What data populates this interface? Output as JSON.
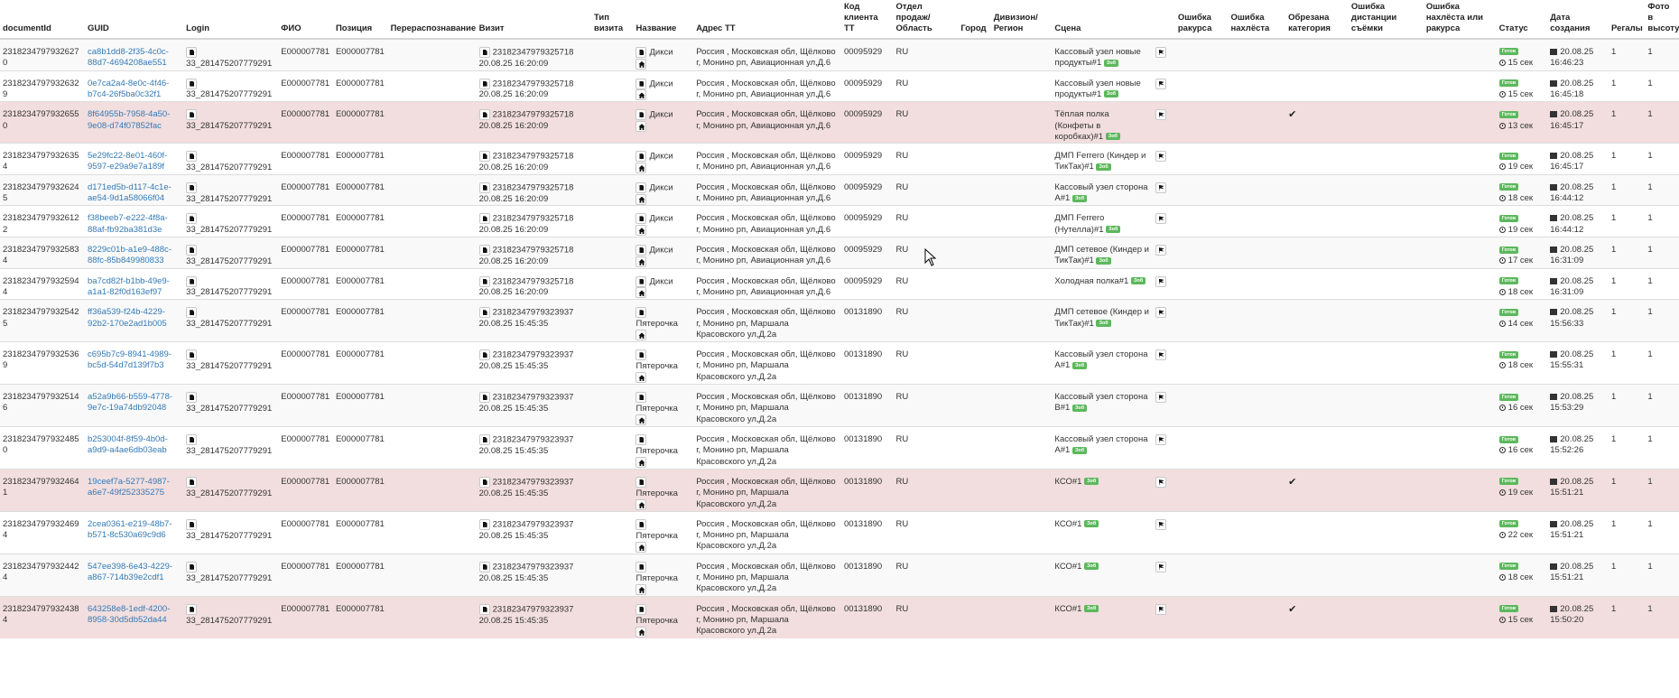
{
  "headers": [
    "documentId",
    "GUID",
    "Login",
    "ФИО",
    "Позиция",
    "Перераспознавание",
    "Визит",
    "Тип визита",
    "Название",
    "Адрес ТТ",
    "Код клиента ТТ",
    "Отдел продаж/ Область",
    "Город",
    "Дивизион/ Регион",
    "Сцена",
    "",
    "Ошибка ракурса",
    "Ошибка нахлёста",
    "Обрезана категория",
    "Ошибка дистанции съёмки",
    "Ошибка нахлёста или ракурса",
    "Статус",
    "Дата создания",
    "Регалы",
    "Фото в высоту"
  ],
  "icons": {
    "file": "file-icon",
    "home": "home-icon",
    "flag": "flag-icon",
    "clock": "clock-icon",
    "calendar": "calendar-icon",
    "check": "checkmark-icon"
  },
  "colors": {
    "highlight_row": "#f2dede",
    "badge": "#5cb85c",
    "link": "#337ab7"
  },
  "rows": [
    {
      "doc": "2318234797932627‍0",
      "guid": "ca8b1dd8-2f35-4c0c-88d7-4694208ae551",
      "login": "33_281475207779291",
      "fio": "E000007781",
      "pos": "E000007781",
      "visit_id": "2318234797932571‍8",
      "visit_time": "20.08.25 16:20:09",
      "store": "Дикси",
      "addr": "Россия , Московская обл, Щёлково г, Монино рп, Авиационная ул,Д.6",
      "code": "00095929",
      "region": "RU",
      "scene": "Кассовый узел новые продукты#1",
      "crop": false,
      "status": "Готов",
      "dur": "15 сек",
      "created_d": "20.08.25",
      "created_t": "16:46:23",
      "regals": "1",
      "photo": "1",
      "hl": false
    },
    {
      "doc": "2318234797932632‍9",
      "guid": "0e7ca2a4-8e0c-4f46-b7c4-26f5ba0c32f1",
      "login": "33_281475207779291",
      "fio": "E000007781",
      "pos": "E000007781",
      "visit_id": "2318234797932571‍8",
      "visit_time": "20.08.25 16:20:09",
      "store": "Дикси",
      "addr": "Россия , Московская обл, Щёлково г, Монино рп, Авиационная ул,Д.6",
      "code": "00095929",
      "region": "RU",
      "scene": "Кассовый узел новые продукты#1",
      "crop": false,
      "status": "Готов",
      "dur": "15 сек",
      "created_d": "20.08.25",
      "created_t": "16:45:18",
      "regals": "1",
      "photo": "1",
      "hl": false
    },
    {
      "doc": "2318234797932655‍0",
      "guid": "8f64955b-7958-4a50-9e08-d74f07852fac",
      "login": "33_281475207779291",
      "fio": "E000007781",
      "pos": "E000007781",
      "visit_id": "2318234797932571‍8",
      "visit_time": "20.08.25 16:20:09",
      "store": "Дикси",
      "addr": "Россия , Московская обл, Щёлково г, Монино рп, Авиационная ул,Д.6",
      "code": "00095929",
      "region": "RU",
      "scene": "Тёплая полка (Конфеты в коробках)#1",
      "crop": true,
      "status": "Готов",
      "dur": "13 сек",
      "created_d": "20.08.25",
      "created_t": "16:45:17",
      "regals": "1",
      "photo": "1",
      "hl": true
    },
    {
      "doc": "2318234797932635‍4",
      "guid": "5e29fc22-8e01-460f-9597-e29a9e7a189f",
      "login": "33_281475207779291",
      "fio": "E000007781",
      "pos": "E000007781",
      "visit_id": "2318234797932571‍8",
      "visit_time": "20.08.25 16:20:09",
      "store": "Дикси",
      "addr": "Россия , Московская обл, Щёлково г, Монино рп, Авиационная ул,Д.6",
      "code": "00095929",
      "region": "RU",
      "scene": "ДМП Ferrero (Киндер и ТикТак)#1",
      "crop": false,
      "status": "Готов",
      "dur": "19 сек",
      "created_d": "20.08.25",
      "created_t": "16:45:17",
      "regals": "1",
      "photo": "1",
      "hl": false
    },
    {
      "doc": "2318234797932624‍5",
      "guid": "d171ed5b-d117-4c1e-ae54-9d1a58066f04",
      "login": "33_281475207779291",
      "fio": "E000007781",
      "pos": "E000007781",
      "visit_id": "2318234797932571‍8",
      "visit_time": "20.08.25 16:20:09",
      "store": "Дикси",
      "addr": "Россия , Московская обл, Щёлково г, Монино рп, Авиационная ул,Д.6",
      "code": "00095929",
      "region": "RU",
      "scene": "Кассовый узел сторона А#1",
      "crop": false,
      "status": "Готов",
      "dur": "18 сек",
      "created_d": "20.08.25",
      "created_t": "16:44:12",
      "regals": "1",
      "photo": "1",
      "hl": false
    },
    {
      "doc": "2318234797932612‍2",
      "guid": "f38beeb7-e222-4f8a-88af-fb92ba381d3e",
      "login": "33_281475207779291",
      "fio": "E000007781",
      "pos": "E000007781",
      "visit_id": "2318234797932571‍8",
      "visit_time": "20.08.25 16:20:09",
      "store": "Дикси",
      "addr": "Россия , Московская обл, Щёлково г, Монино рп, Авиационная ул,Д.6",
      "code": "00095929",
      "region": "RU",
      "scene": "ДМП Ferrero (Нутелла)#1",
      "crop": false,
      "status": "Готов",
      "dur": "19 сек",
      "created_d": "20.08.25",
      "created_t": "16:44:12",
      "regals": "1",
      "photo": "1",
      "hl": false
    },
    {
      "doc": "2318234797932583‍4",
      "guid": "8229c01b-a1e9-488c-88fc-85b849980833",
      "login": "33_281475207779291",
      "fio": "E000007781",
      "pos": "E000007781",
      "visit_id": "2318234797932571‍8",
      "visit_time": "20.08.25 16:20:09",
      "store": "Дикси",
      "addr": "Россия , Московская обл, Щёлково г, Монино рп, Авиационная ул,Д.6",
      "code": "00095929",
      "region": "RU",
      "scene": "ДМП сетевое (Киндер и ТикТак)#1",
      "crop": false,
      "status": "Готов",
      "dur": "17 сек",
      "created_d": "20.08.25",
      "created_t": "16:31:09",
      "regals": "1",
      "photo": "1",
      "hl": false
    },
    {
      "doc": "2318234797932594‍4",
      "guid": "ba7cd82f-b1bb-49e9-a1a1-82f0d163ef97",
      "login": "33_281475207779291",
      "fio": "E000007781",
      "pos": "E000007781",
      "visit_id": "2318234797932571‍8",
      "visit_time": "20.08.25 16:20:09",
      "store": "Дикси",
      "addr": "Россия , Московская обл, Щёлково г, Монино рп, Авиационная ул,Д.6",
      "code": "00095929",
      "region": "RU",
      "scene": "Холодная полка#1",
      "crop": false,
      "status": "Готов",
      "dur": "18 сек",
      "created_d": "20.08.25",
      "created_t": "16:31:09",
      "regals": "1",
      "photo": "1",
      "hl": false
    },
    {
      "doc": "2318234797932542‍5",
      "guid": "ff36a539-f24b-4229-92b2-170e2ad1b005",
      "login": "33_281475207779291",
      "fio": "E000007781",
      "pos": "E000007781",
      "visit_id": "2318234797932393‍7",
      "visit_time": "20.08.25 15:45:35",
      "store": "Пятерочка",
      "addr": "Россия , Московская обл, Щёлково г, Монино рп, Маршала Красовского ул,Д.2а",
      "code": "00131890",
      "region": "RU",
      "scene": "ДМП сетевое (Киндер и ТикТак)#1",
      "crop": false,
      "status": "Готов",
      "dur": "14 сек",
      "created_d": "20.08.25",
      "created_t": "15:56:33",
      "regals": "1",
      "photo": "1",
      "hl": false
    },
    {
      "doc": "2318234797932536‍9",
      "guid": "c695b7c9-8941-4989-bc5d-54d7d139f7b3",
      "login": "33_281475207779291",
      "fio": "E000007781",
      "pos": "E000007781",
      "visit_id": "2318234797932393‍7",
      "visit_time": "20.08.25 15:45:35",
      "store": "Пятерочка",
      "addr": "Россия , Московская обл, Щёлково г, Монино рп, Маршала Красовского ул,Д.2а",
      "code": "00131890",
      "region": "RU",
      "scene": "Кассовый узел сторона А#1",
      "crop": false,
      "status": "Готов",
      "dur": "18 сек",
      "created_d": "20.08.25",
      "created_t": "15:55:31",
      "regals": "1",
      "photo": "1",
      "hl": false
    },
    {
      "doc": "2318234797932514‍6",
      "guid": "a52a9b66-b559-4778-9e7c-19a74db92048",
      "login": "33_281475207779291",
      "fio": "E000007781",
      "pos": "E000007781",
      "visit_id": "2318234797932393‍7",
      "visit_time": "20.08.25 15:45:35",
      "store": "Пятерочка",
      "addr": "Россия , Московская обл, Щёлково г, Монино рп, Маршала Красовского ул,Д.2а",
      "code": "00131890",
      "region": "RU",
      "scene": "Кассовый узел сторона В#1",
      "crop": false,
      "status": "Готов",
      "dur": "16 сек",
      "created_d": "20.08.25",
      "created_t": "15:53:29",
      "regals": "1",
      "photo": "1",
      "hl": false
    },
    {
      "doc": "2318234797932485‍0",
      "guid": "b253004f-8f59-4b0d-a9d9-a4ae6db03eab",
      "login": "33_281475207779291",
      "fio": "E000007781",
      "pos": "E000007781",
      "visit_id": "2318234797932393‍7",
      "visit_time": "20.08.25 15:45:35",
      "store": "Пятерочка",
      "addr": "Россия , Московская обл, Щёлково г, Монино рп, Маршала Красовского ул,Д.2а",
      "code": "00131890",
      "region": "RU",
      "scene": "Кассовый узел сторона А#1",
      "crop": false,
      "status": "Готов",
      "dur": "16 сек",
      "created_d": "20.08.25",
      "created_t": "15:52:26",
      "regals": "1",
      "photo": "1",
      "hl": false
    },
    {
      "doc": "2318234797932464‍1",
      "guid": "19ceef7a-5277-4987-a6e7-49f252335275",
      "login": "33_281475207779291",
      "fio": "E000007781",
      "pos": "E000007781",
      "visit_id": "2318234797932393‍7",
      "visit_time": "20.08.25 15:45:35",
      "store": "Пятерочка",
      "addr": "Россия , Московская обл, Щёлково г, Монино рп, Маршала Красовского ул,Д.2а",
      "code": "00131890",
      "region": "RU",
      "scene": "КСО#1",
      "crop": true,
      "status": "Готов",
      "dur": "19 сек",
      "created_d": "20.08.25",
      "created_t": "15:51:21",
      "regals": "1",
      "photo": "1",
      "hl": true
    },
    {
      "doc": "2318234797932469‍4",
      "guid": "2cea0361-e219-48b7-b571-8c530a69c9d6",
      "login": "33_281475207779291",
      "fio": "E000007781",
      "pos": "E000007781",
      "visit_id": "2318234797932393‍7",
      "visit_time": "20.08.25 15:45:35",
      "store": "Пятерочка",
      "addr": "Россия , Московская обл, Щёлково г, Монино рп, Маршала Красовского ул,Д.2а",
      "code": "00131890",
      "region": "RU",
      "scene": "КСО#1",
      "crop": false,
      "status": "Готов",
      "dur": "22 сек",
      "created_d": "20.08.25",
      "created_t": "15:51:21",
      "regals": "1",
      "photo": "1",
      "hl": false
    },
    {
      "doc": "2318234797932442‍4",
      "guid": "547ee398-6e43-4229-a867-714b39e2cdf1",
      "login": "33_281475207779291",
      "fio": "E000007781",
      "pos": "E000007781",
      "visit_id": "2318234797932393‍7",
      "visit_time": "20.08.25 15:45:35",
      "store": "Пятерочка",
      "addr": "Россия , Московская обл, Щёлково г, Монино рп, Маршала Красовского ул,Д.2а",
      "code": "00131890",
      "region": "RU",
      "scene": "КСО#1",
      "crop": false,
      "status": "Готов",
      "dur": "18 сек",
      "created_d": "20.08.25",
      "created_t": "15:51:21",
      "regals": "1",
      "photo": "1",
      "hl": false
    },
    {
      "doc": "2318234797932438‍4",
      "guid": "643258e8-1edf-4200-8958-30d5db52da44",
      "login": "33_281475207779291",
      "fio": "E000007781",
      "pos": "E000007781",
      "visit_id": "2318234797932393‍7",
      "visit_time": "20.08.25 15:45:35",
      "store": "Пятерочка",
      "addr": "Россия , Московская обл, Щёлково г, Монино рп, Маршала Красовского ул,Д.2а",
      "code": "00131890",
      "region": "RU",
      "scene": "КСО#1",
      "crop": true,
      "status": "Готов",
      "dur": "15 сек",
      "created_d": "20.08.25",
      "created_t": "15:50:20",
      "regals": "1",
      "photo": "1",
      "hl": true
    }
  ],
  "badge_text": "Ⓢ⊘Ⓢ",
  "check_symbol": "✔"
}
